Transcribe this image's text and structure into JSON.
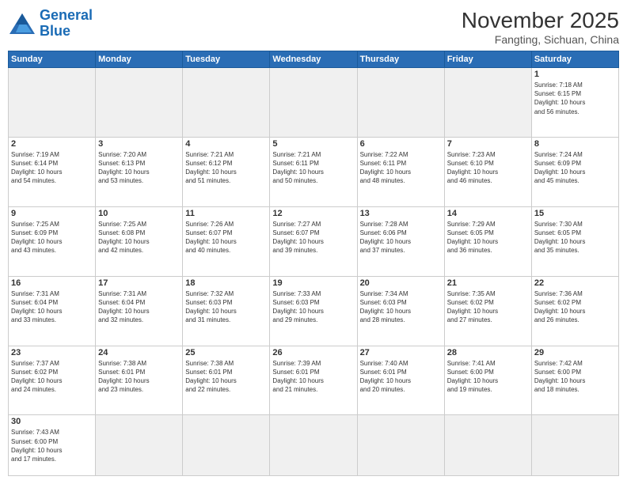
{
  "header": {
    "logo_general": "General",
    "logo_blue": "Blue",
    "month_title": "November 2025",
    "location": "Fangting, Sichuan, China"
  },
  "weekdays": [
    "Sunday",
    "Monday",
    "Tuesday",
    "Wednesday",
    "Thursday",
    "Friday",
    "Saturday"
  ],
  "weeks": [
    [
      {
        "day": "",
        "info": "",
        "empty": true
      },
      {
        "day": "",
        "info": "",
        "empty": true
      },
      {
        "day": "",
        "info": "",
        "empty": true
      },
      {
        "day": "",
        "info": "",
        "empty": true
      },
      {
        "day": "",
        "info": "",
        "empty": true
      },
      {
        "day": "",
        "info": "",
        "empty": true
      },
      {
        "day": "1",
        "info": "Sunrise: 7:18 AM\nSunset: 6:15 PM\nDaylight: 10 hours\nand 56 minutes."
      }
    ],
    [
      {
        "day": "2",
        "info": "Sunrise: 7:19 AM\nSunset: 6:14 PM\nDaylight: 10 hours\nand 54 minutes."
      },
      {
        "day": "3",
        "info": "Sunrise: 7:20 AM\nSunset: 6:13 PM\nDaylight: 10 hours\nand 53 minutes."
      },
      {
        "day": "4",
        "info": "Sunrise: 7:21 AM\nSunset: 6:12 PM\nDaylight: 10 hours\nand 51 minutes."
      },
      {
        "day": "5",
        "info": "Sunrise: 7:21 AM\nSunset: 6:11 PM\nDaylight: 10 hours\nand 50 minutes."
      },
      {
        "day": "6",
        "info": "Sunrise: 7:22 AM\nSunset: 6:11 PM\nDaylight: 10 hours\nand 48 minutes."
      },
      {
        "day": "7",
        "info": "Sunrise: 7:23 AM\nSunset: 6:10 PM\nDaylight: 10 hours\nand 46 minutes."
      },
      {
        "day": "8",
        "info": "Sunrise: 7:24 AM\nSunset: 6:09 PM\nDaylight: 10 hours\nand 45 minutes."
      }
    ],
    [
      {
        "day": "9",
        "info": "Sunrise: 7:25 AM\nSunset: 6:09 PM\nDaylight: 10 hours\nand 43 minutes."
      },
      {
        "day": "10",
        "info": "Sunrise: 7:25 AM\nSunset: 6:08 PM\nDaylight: 10 hours\nand 42 minutes."
      },
      {
        "day": "11",
        "info": "Sunrise: 7:26 AM\nSunset: 6:07 PM\nDaylight: 10 hours\nand 40 minutes."
      },
      {
        "day": "12",
        "info": "Sunrise: 7:27 AM\nSunset: 6:07 PM\nDaylight: 10 hours\nand 39 minutes."
      },
      {
        "day": "13",
        "info": "Sunrise: 7:28 AM\nSunset: 6:06 PM\nDaylight: 10 hours\nand 37 minutes."
      },
      {
        "day": "14",
        "info": "Sunrise: 7:29 AM\nSunset: 6:05 PM\nDaylight: 10 hours\nand 36 minutes."
      },
      {
        "day": "15",
        "info": "Sunrise: 7:30 AM\nSunset: 6:05 PM\nDaylight: 10 hours\nand 35 minutes."
      }
    ],
    [
      {
        "day": "16",
        "info": "Sunrise: 7:31 AM\nSunset: 6:04 PM\nDaylight: 10 hours\nand 33 minutes."
      },
      {
        "day": "17",
        "info": "Sunrise: 7:31 AM\nSunset: 6:04 PM\nDaylight: 10 hours\nand 32 minutes."
      },
      {
        "day": "18",
        "info": "Sunrise: 7:32 AM\nSunset: 6:03 PM\nDaylight: 10 hours\nand 31 minutes."
      },
      {
        "day": "19",
        "info": "Sunrise: 7:33 AM\nSunset: 6:03 PM\nDaylight: 10 hours\nand 29 minutes."
      },
      {
        "day": "20",
        "info": "Sunrise: 7:34 AM\nSunset: 6:03 PM\nDaylight: 10 hours\nand 28 minutes."
      },
      {
        "day": "21",
        "info": "Sunrise: 7:35 AM\nSunset: 6:02 PM\nDaylight: 10 hours\nand 27 minutes."
      },
      {
        "day": "22",
        "info": "Sunrise: 7:36 AM\nSunset: 6:02 PM\nDaylight: 10 hours\nand 26 minutes."
      }
    ],
    [
      {
        "day": "23",
        "info": "Sunrise: 7:37 AM\nSunset: 6:02 PM\nDaylight: 10 hours\nand 24 minutes."
      },
      {
        "day": "24",
        "info": "Sunrise: 7:38 AM\nSunset: 6:01 PM\nDaylight: 10 hours\nand 23 minutes."
      },
      {
        "day": "25",
        "info": "Sunrise: 7:38 AM\nSunset: 6:01 PM\nDaylight: 10 hours\nand 22 minutes."
      },
      {
        "day": "26",
        "info": "Sunrise: 7:39 AM\nSunset: 6:01 PM\nDaylight: 10 hours\nand 21 minutes."
      },
      {
        "day": "27",
        "info": "Sunrise: 7:40 AM\nSunset: 6:01 PM\nDaylight: 10 hours\nand 20 minutes."
      },
      {
        "day": "28",
        "info": "Sunrise: 7:41 AM\nSunset: 6:00 PM\nDaylight: 10 hours\nand 19 minutes."
      },
      {
        "day": "29",
        "info": "Sunrise: 7:42 AM\nSunset: 6:00 PM\nDaylight: 10 hours\nand 18 minutes."
      }
    ],
    [
      {
        "day": "30",
        "info": "Sunrise: 7:43 AM\nSunset: 6:00 PM\nDaylight: 10 hours\nand 17 minutes.",
        "last": true
      },
      {
        "day": "",
        "info": "",
        "empty": true,
        "last": true
      },
      {
        "day": "",
        "info": "",
        "empty": true,
        "last": true
      },
      {
        "day": "",
        "info": "",
        "empty": true,
        "last": true
      },
      {
        "day": "",
        "info": "",
        "empty": true,
        "last": true
      },
      {
        "day": "",
        "info": "",
        "empty": true,
        "last": true
      },
      {
        "day": "",
        "info": "",
        "empty": true,
        "last": true
      }
    ]
  ]
}
